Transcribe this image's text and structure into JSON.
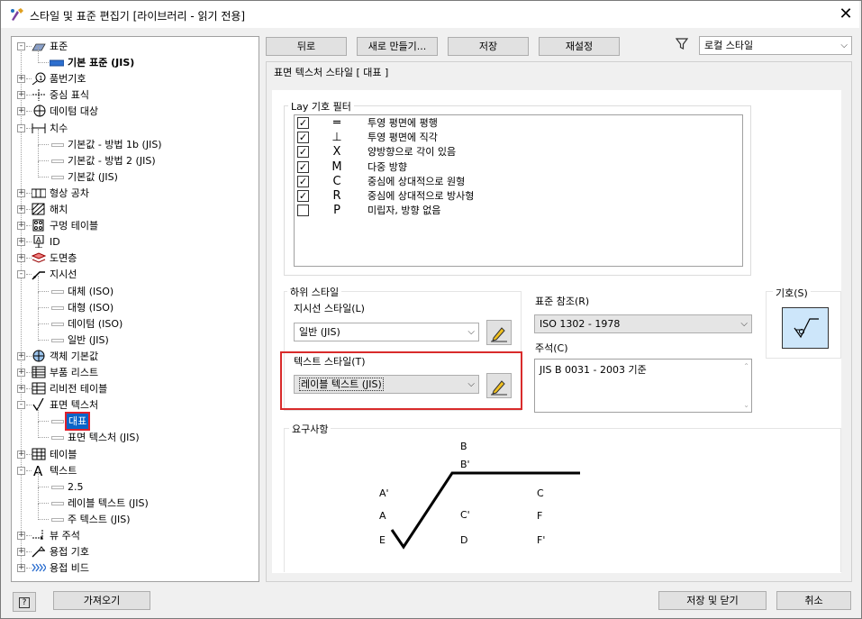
{
  "window": {
    "title": "스타일 및 표준 편집기 [라이브러리 - 읽기 전용]"
  },
  "tree": {
    "items": [
      {
        "label": "표준",
        "level": 0,
        "expand": "-",
        "icon": "standard-icon"
      },
      {
        "label": "기본 표준 (JIS)",
        "level": 1,
        "bold": true,
        "icon": "standard-leaf-icon"
      },
      {
        "label": "품번기호",
        "level": 0,
        "expand": "+",
        "icon": "balloon-icon"
      },
      {
        "label": "중심 표식",
        "level": 0,
        "expand": "+",
        "icon": "center-mark-icon"
      },
      {
        "label": "데이텀 대상",
        "level": 0,
        "expand": "+",
        "icon": "datum-target-icon"
      },
      {
        "label": "치수",
        "level": 0,
        "expand": "-",
        "icon": "dimension-icon"
      },
      {
        "label": "기본값 - 방법 1b (JIS)",
        "level": 1
      },
      {
        "label": "기본값 - 방법 2 (JIS)",
        "level": 1
      },
      {
        "label": "기본값 (JIS)",
        "level": 1
      },
      {
        "label": "형상 공차",
        "level": 0,
        "expand": "+",
        "icon": "feature-control-icon"
      },
      {
        "label": "해치",
        "level": 0,
        "expand": "+",
        "icon": "hatch-icon"
      },
      {
        "label": "구멍 테이블",
        "level": 0,
        "expand": "+",
        "icon": "hole-table-icon"
      },
      {
        "label": "ID",
        "level": 0,
        "expand": "+",
        "icon": "id-icon"
      },
      {
        "label": "도면층",
        "level": 0,
        "expand": "+",
        "icon": "layer-icon"
      },
      {
        "label": "지시선",
        "level": 0,
        "expand": "-",
        "icon": "leader-icon"
      },
      {
        "label": "대체 (ISO)",
        "level": 1
      },
      {
        "label": "대형 (ISO)",
        "level": 1
      },
      {
        "label": "데이텀 (ISO)",
        "level": 1
      },
      {
        "label": "일반 (JIS)",
        "level": 1
      },
      {
        "label": "객체 기본값",
        "level": 0,
        "expand": "+",
        "icon": "object-defaults-icon"
      },
      {
        "label": "부품 리스트",
        "level": 0,
        "expand": "+",
        "icon": "parts-list-icon"
      },
      {
        "label": "리비전 테이블",
        "level": 0,
        "expand": "+",
        "icon": "revision-table-icon"
      },
      {
        "label": "표면 텍스처",
        "level": 0,
        "expand": "-",
        "icon": "surface-texture-icon"
      },
      {
        "label": "대표",
        "level": 1,
        "selected": true
      },
      {
        "label": "표면 텍스처 (JIS)",
        "level": 1
      },
      {
        "label": "테이블",
        "level": 0,
        "expand": "+",
        "icon": "table-icon"
      },
      {
        "label": "텍스트",
        "level": 0,
        "expand": "-",
        "icon": "text-icon"
      },
      {
        "label": "2.5",
        "level": 1
      },
      {
        "label": "레이블 텍스트 (JIS)",
        "level": 1
      },
      {
        "label": "주 텍스트 (JIS)",
        "level": 1
      },
      {
        "label": "뷰 주석",
        "level": 0,
        "expand": "+",
        "icon": "view-annotation-icon"
      },
      {
        "label": "용접 기호",
        "level": 0,
        "expand": "+",
        "icon": "weld-symbol-icon"
      },
      {
        "label": "용접 비드",
        "level": 0,
        "expand": "+",
        "icon": "weld-bead-icon"
      }
    ]
  },
  "toolbar": {
    "back": "뒤로",
    "new": "새로 만들기...",
    "save": "저장",
    "reset": "재설정",
    "filter_value": "로컬 스타일"
  },
  "panel": {
    "title": "표면 텍스처 스타일 [ 대표 ]",
    "lay_filter": {
      "title": "Lay 기호 필터",
      "items": [
        {
          "symbol": "═",
          "label": "투영 평면에 평행",
          "checked": true
        },
        {
          "symbol": "⊥",
          "label": "투영 평면에 직각",
          "checked": true
        },
        {
          "symbol": "X",
          "label": "양방향으로 각이 있음",
          "checked": true
        },
        {
          "symbol": "M",
          "label": "다중 방향",
          "checked": true
        },
        {
          "symbol": "C",
          "label": "중심에 상대적으로 원형",
          "checked": true
        },
        {
          "symbol": "R",
          "label": "중심에 상대적으로 방사형",
          "checked": true
        },
        {
          "symbol": "P",
          "label": "미립자, 방향 없음",
          "checked": false
        }
      ]
    },
    "sub_style": {
      "title": "하위 스타일",
      "leader_label": "지시선 스타일(L)",
      "leader_value": "일반 (JIS)",
      "text_label": "텍스트 스타일(T)",
      "text_value": "레이블 텍스트 (JIS)"
    },
    "standard_ref": {
      "label": "표준 참조(R)",
      "value": "ISO 1302 - 1978"
    },
    "comment": {
      "label": "주석(C)",
      "value": "JIS B 0031 - 2003 기준"
    },
    "symbol": {
      "title": "기호(S)"
    },
    "requirements": {
      "title": "요구사항",
      "labels": {
        "B": "B",
        "B2": "B'",
        "A2": "A'",
        "A": "A",
        "E": "E",
        "C2": "C'",
        "D": "D",
        "C": "C",
        "F": "F",
        "F2": "F'"
      }
    }
  },
  "footer": {
    "import": "가져오기",
    "save_close": "저장 및 닫기",
    "cancel": "취소",
    "help": "?"
  }
}
